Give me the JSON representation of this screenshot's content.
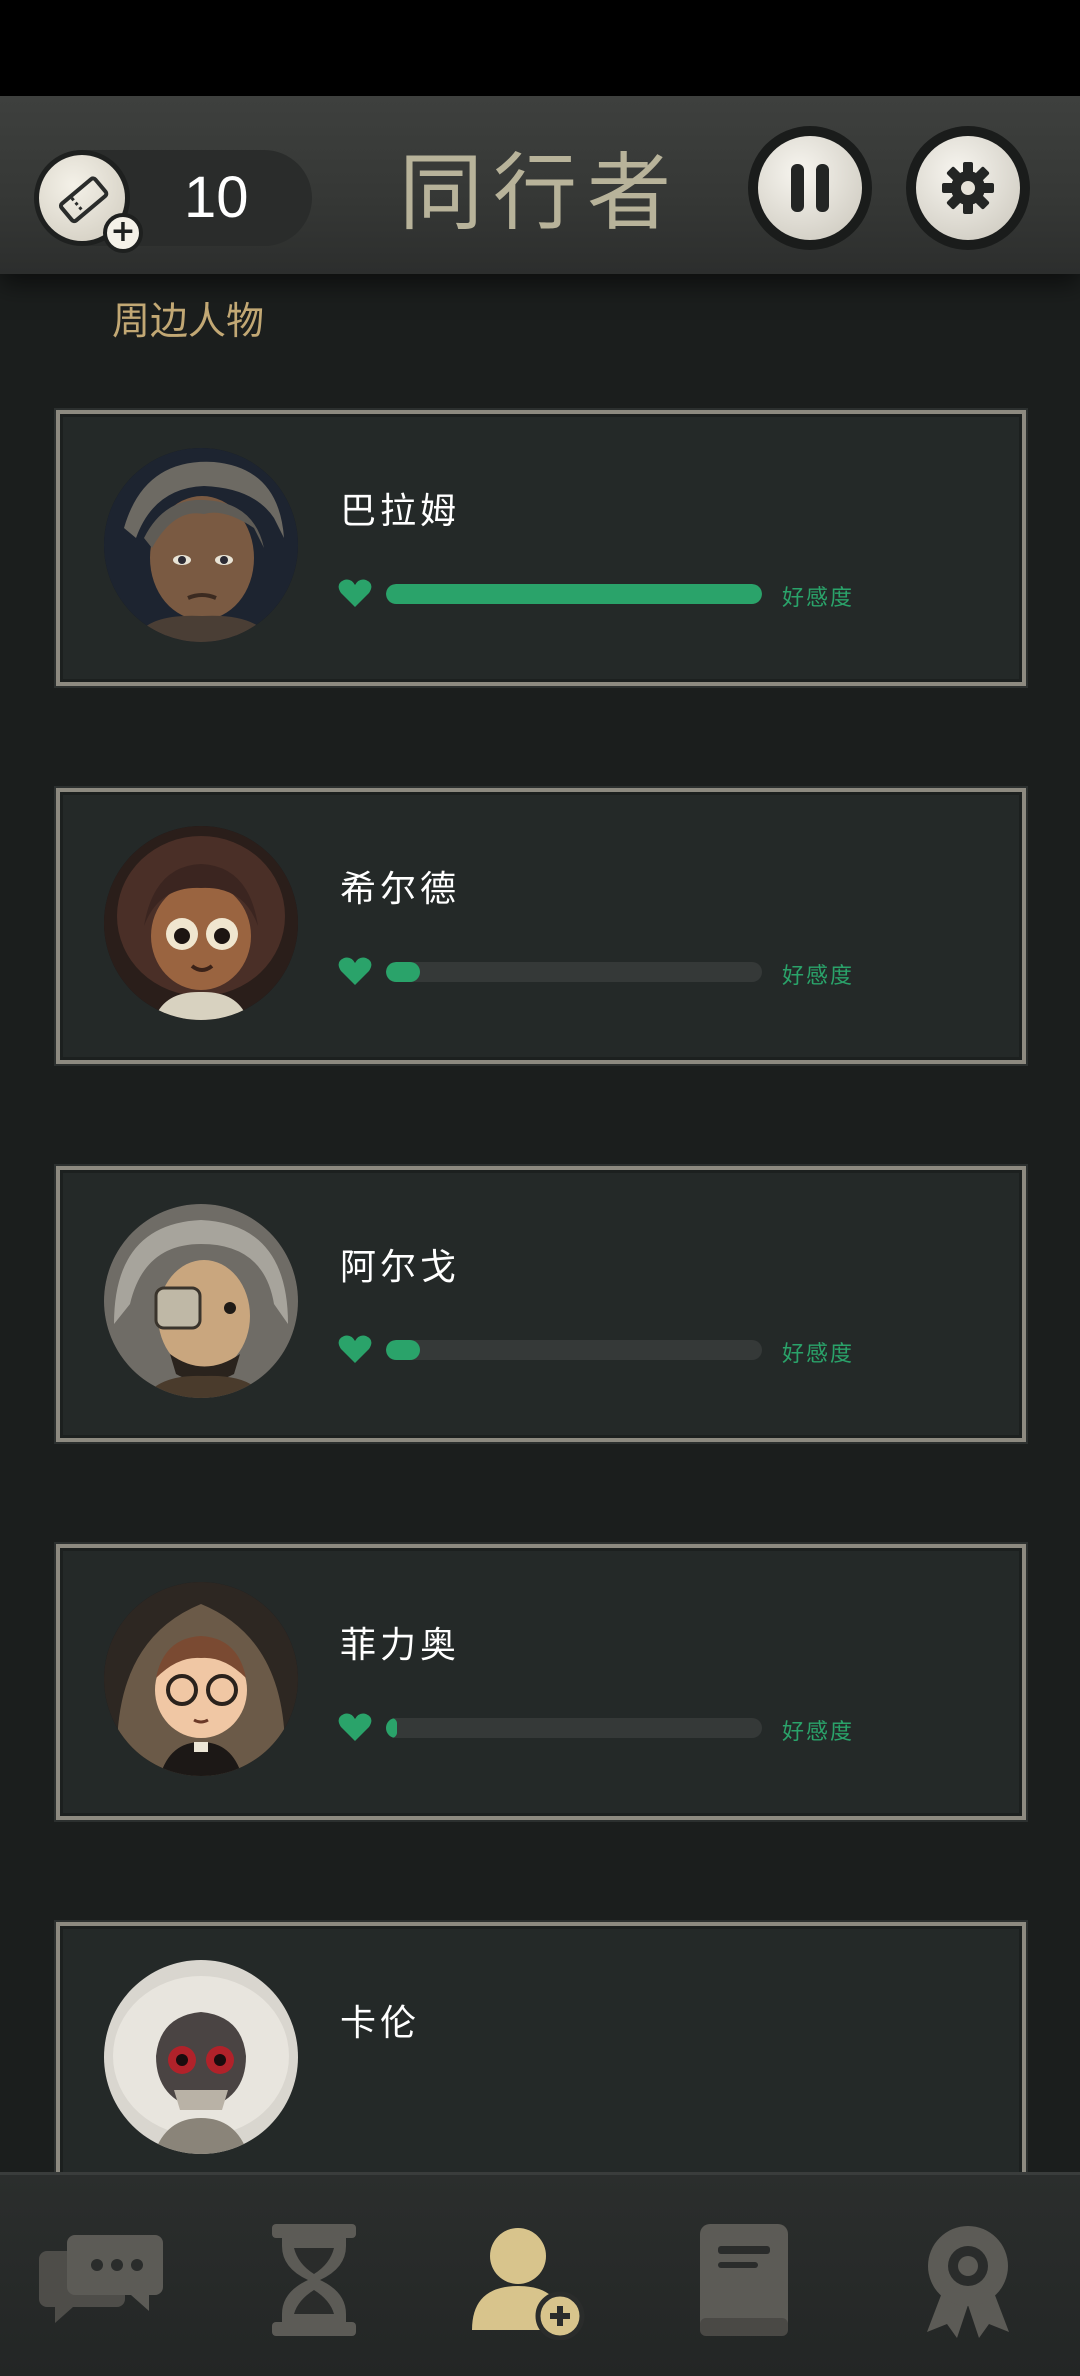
{
  "header": {
    "ticket_count": "10",
    "title": "同行者",
    "icons": {
      "ticket": "ticket-add-icon",
      "pause": "pause-icon",
      "settings": "gear-icon"
    }
  },
  "section_label": "周边人物",
  "characters": [
    {
      "name": "巴拉姆",
      "affection": 1.0,
      "affection_label": "好感度"
    },
    {
      "name": "希尔德",
      "affection": 0.09,
      "affection_label": "好感度"
    },
    {
      "name": "阿尔戈",
      "affection": 0.09,
      "affection_label": "好感度"
    },
    {
      "name": "菲力奥",
      "affection": 0.03,
      "affection_label": "好感度"
    },
    {
      "name": "卡伦"
    }
  ],
  "bottom_nav": [
    {
      "icon": "chat-icon",
      "active": false
    },
    {
      "icon": "hourglass-icon",
      "active": false
    },
    {
      "icon": "companions-icon",
      "active": true
    },
    {
      "icon": "book-icon",
      "active": false
    },
    {
      "icon": "achievement-icon",
      "active": false
    }
  ],
  "colors": {
    "accent_green": "#2aa36a",
    "section_gold": "#c2a874",
    "title": "#b8b39a",
    "nav_active": "#d8c48c",
    "nav_inactive": "#5c5b56"
  }
}
